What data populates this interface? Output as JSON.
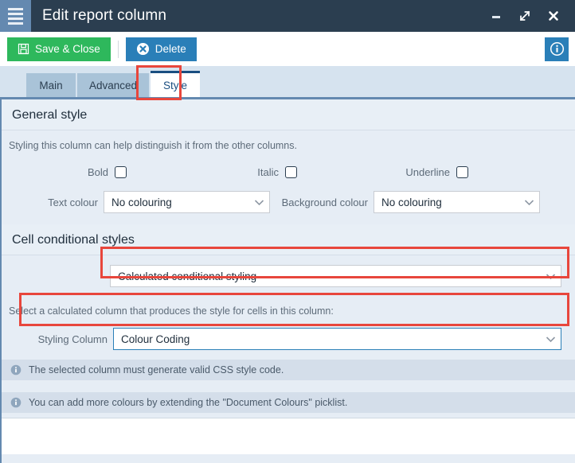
{
  "window": {
    "title": "Edit report column",
    "menu_icon": "hamburger-icon",
    "controls": [
      {
        "name": "minimize-button",
        "icon": "minimize-icon"
      },
      {
        "name": "maximize-button",
        "icon": "maximize-diagonal-icon"
      },
      {
        "name": "close-button",
        "icon": "close-icon"
      }
    ],
    "titlebar_color": "#2b3e50",
    "menu_button_color": "#6489b0"
  },
  "toolbar": {
    "save_label": "Save & Close",
    "save_icon": "save-floppy-icon",
    "save_color": "#2eb85c",
    "delete_label": "Delete",
    "delete_icon": "delete-circle-x-icon",
    "delete_color": "#2a7fb8",
    "info_icon": "info-circle-icon",
    "info_color": "#2a7fb8"
  },
  "tabs": [
    {
      "label": "Main",
      "active": false
    },
    {
      "label": "Advanced",
      "active": false
    },
    {
      "label": "Style",
      "active": true
    }
  ],
  "highlight_color": "#e8463c",
  "general_style": {
    "heading": "General style",
    "description": "Styling this column can help distinguish it from the other columns.",
    "checkboxes": [
      {
        "label": "Bold",
        "checked": false
      },
      {
        "label": "Italic",
        "checked": false
      },
      {
        "label": "Underline",
        "checked": false
      }
    ],
    "text_colour": {
      "label": "Text colour",
      "value": "No colouring",
      "chevron": "chevron-down-icon"
    },
    "background_colour": {
      "label": "Background colour",
      "value": "No colouring",
      "chevron": "chevron-down-icon"
    }
  },
  "cell_conditional_styles": {
    "heading": "Cell conditional styles",
    "mode": {
      "value": "Calculated conditional styling",
      "chevron": "chevron-down-icon",
      "highlighted": true
    },
    "instruction": "Select a calculated column that produces the style for cells in this column:",
    "styling_column": {
      "label": "Styling Column",
      "value": "Colour Coding",
      "chevron": "chevron-down-icon",
      "highlighted": true,
      "border_color": "#2a7fb8"
    },
    "info_messages": [
      {
        "icon": "info-circle-icon",
        "text": "The selected column must generate valid CSS style code."
      },
      {
        "icon": "info-circle-icon",
        "text": "You can add more colours by extending the \"Document Colours\" picklist."
      }
    ]
  }
}
